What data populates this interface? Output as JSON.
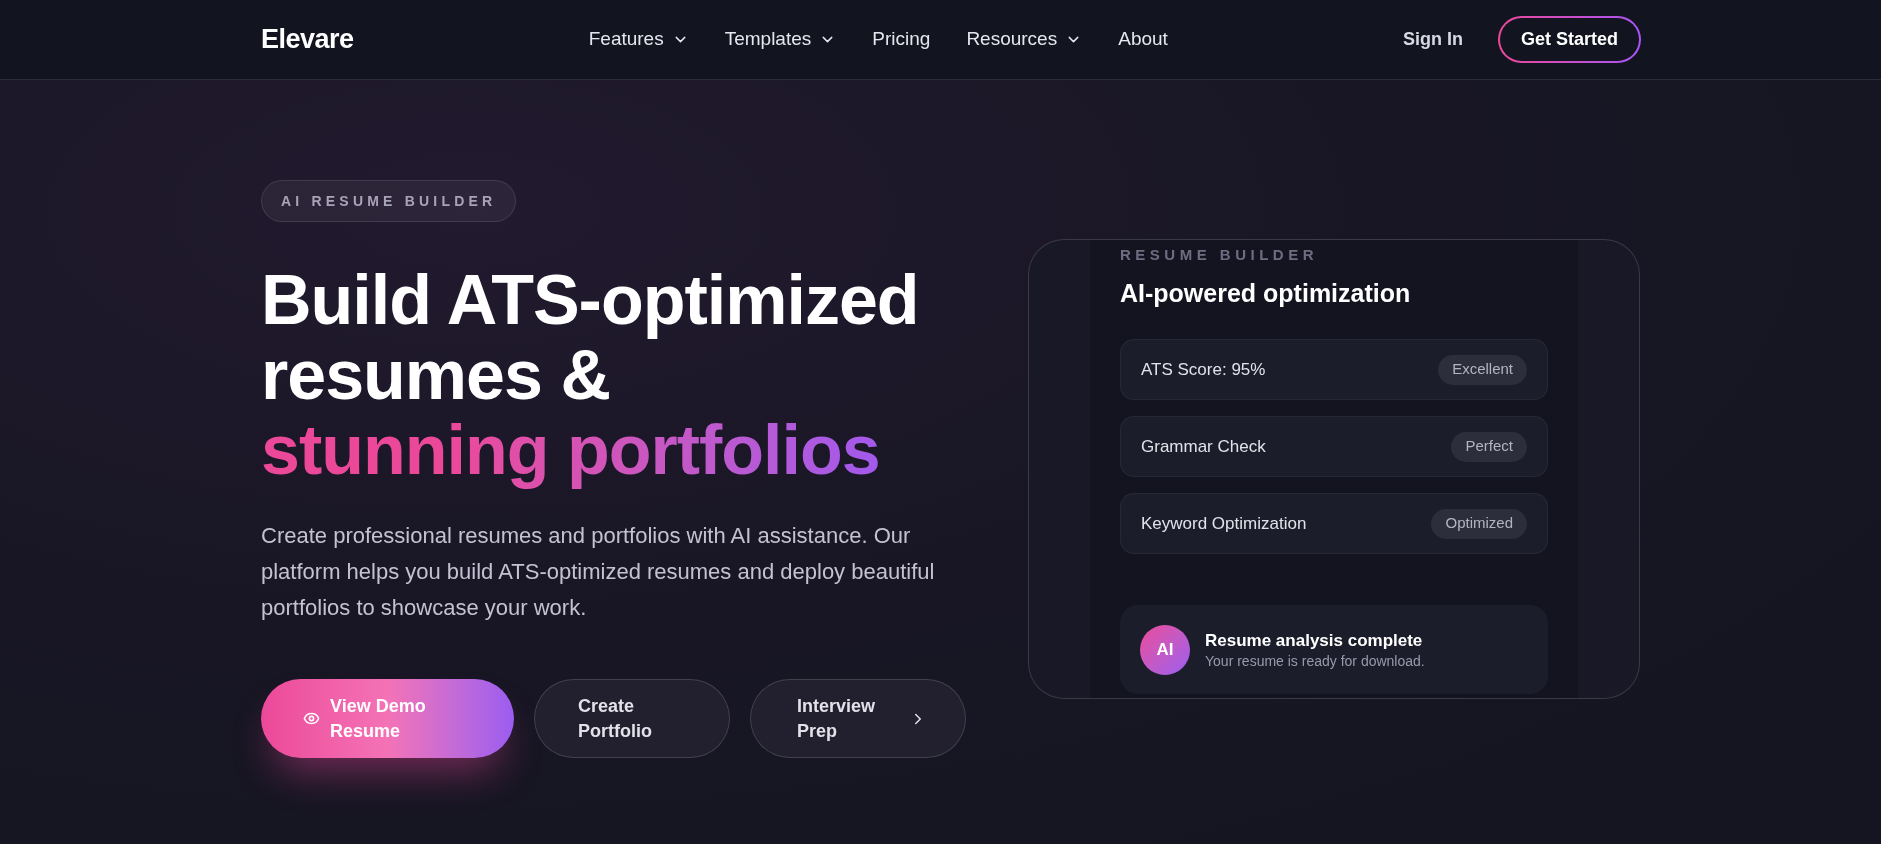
{
  "nav": {
    "logo": "Elevare",
    "links": [
      {
        "label": "Features",
        "has_menu": true
      },
      {
        "label": "Templates",
        "has_menu": true
      },
      {
        "label": "Pricing",
        "has_menu": false
      },
      {
        "label": "Resources",
        "has_menu": true
      },
      {
        "label": "About",
        "has_menu": false
      }
    ],
    "sign_in": "Sign In",
    "cta": "Get Started"
  },
  "hero": {
    "badge": "AI RESUME BUILDER",
    "headline": "Build ATS-optimized resumes &",
    "headline_highlight": "stunning portfolios",
    "description": "Create professional resumes and portfolios with AI assistance. Our platform helps you build ATS-optimized resumes and deploy beautiful portfolios to showcase your work.",
    "buttons": [
      {
        "label": "View Demo Resume",
        "kind": "primary"
      },
      {
        "label": "Create Portfolio",
        "kind": "secondary"
      },
      {
        "label": "Interview Prep",
        "kind": "next"
      }
    ]
  },
  "preview_card": {
    "eyebrow": "RESUME BUILDER",
    "title": "AI-powered optimization",
    "checks": [
      {
        "label": "ATS Score: 95%",
        "status": "Excellent"
      },
      {
        "label": "Grammar Check",
        "status": "Perfect"
      },
      {
        "label": "Keyword Optimization",
        "status": "Optimized"
      }
    ],
    "notification": {
      "avatar": "AI",
      "title": "Resume analysis complete",
      "message": "Your resume is ready for download."
    }
  }
}
